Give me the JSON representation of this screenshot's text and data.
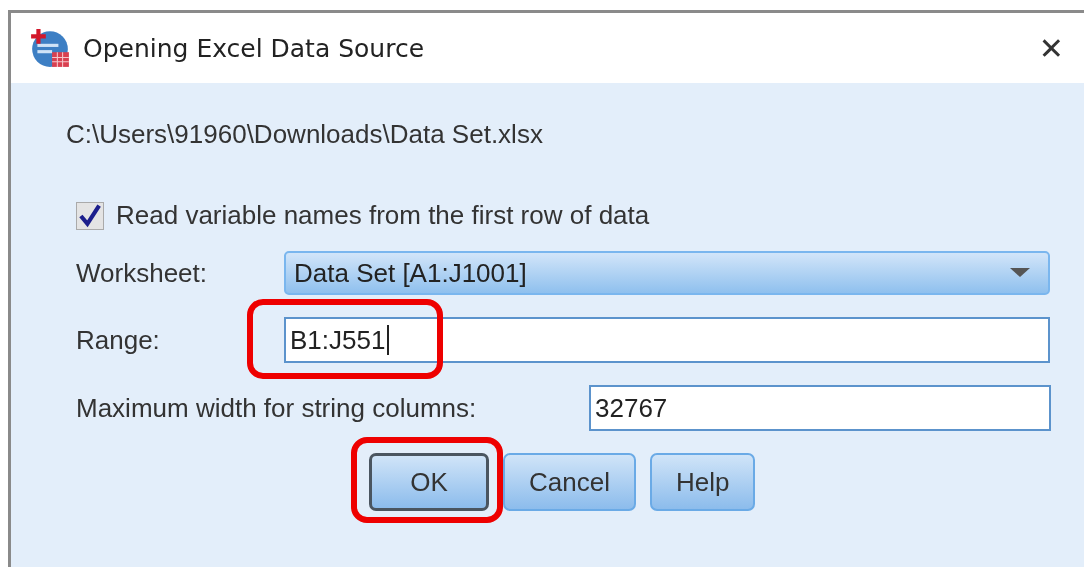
{
  "window": {
    "title": "Opening Excel Data Source",
    "close": "✕"
  },
  "file_path": "C:\\Users\\91960\\Downloads\\Data Set.xlsx",
  "read_names": {
    "label": "Read variable names from the first row of data",
    "checked": true
  },
  "worksheet": {
    "label": "Worksheet:",
    "value": "Data Set [A1:J1001]"
  },
  "range": {
    "label": "Range:",
    "value": "B1:J551",
    "highlighted": true
  },
  "max_width": {
    "label": "Maximum width for string columns:",
    "value": "32767"
  },
  "buttons": [
    {
      "label": "OK",
      "default": true,
      "highlighted": true
    },
    {
      "label": "Cancel",
      "default": false,
      "highlighted": false
    },
    {
      "label": "Help",
      "default": false,
      "highlighted": false
    }
  ]
}
